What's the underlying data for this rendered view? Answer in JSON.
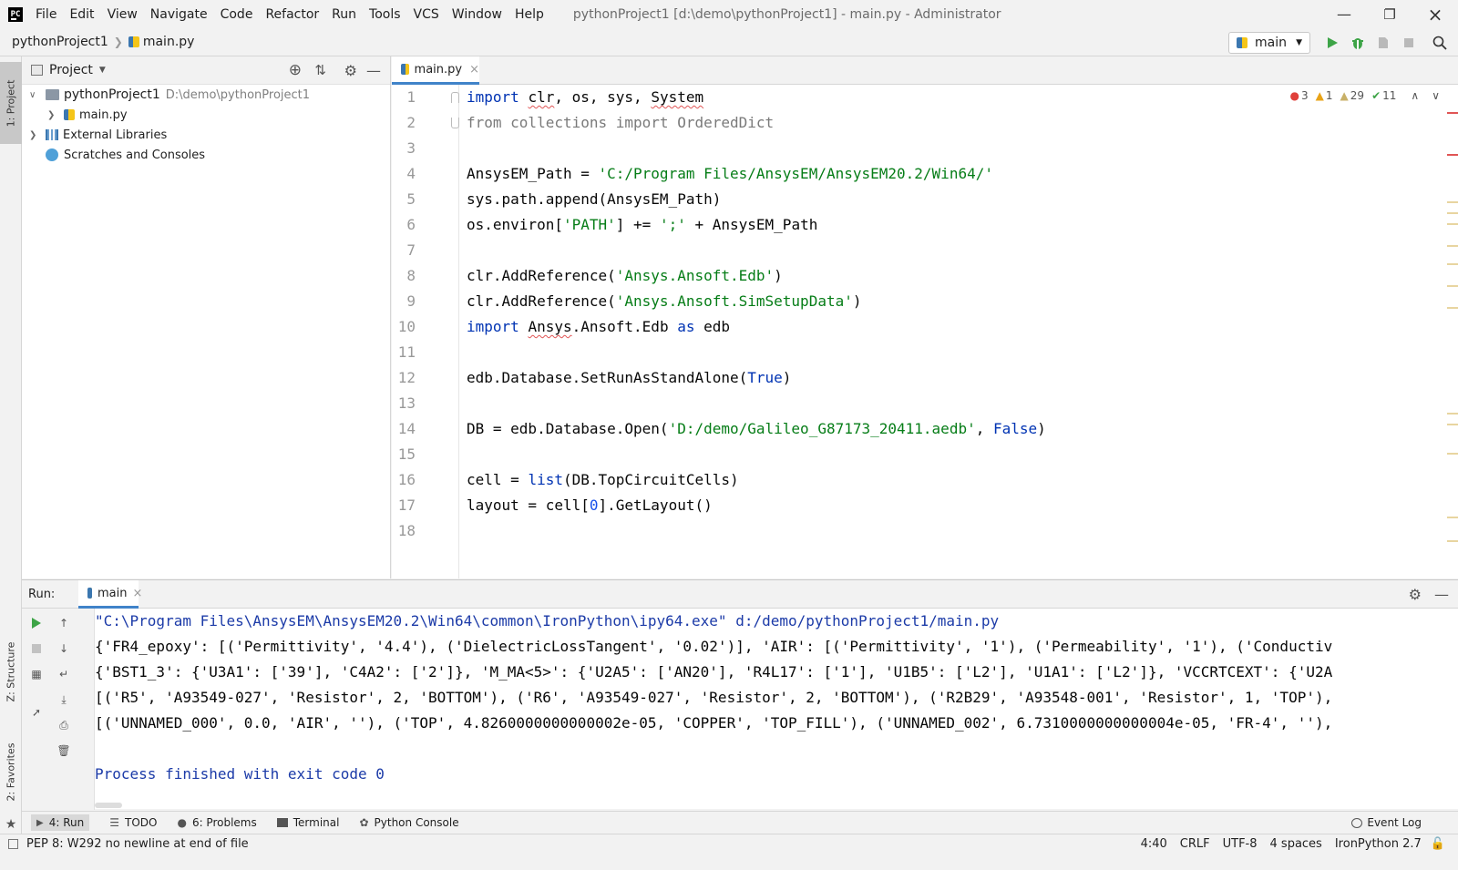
{
  "menu": [
    "File",
    "Edit",
    "View",
    "Navigate",
    "Code",
    "Refactor",
    "Run",
    "Tools",
    "VCS",
    "Window",
    "Help"
  ],
  "window_title": "pythonProject1 [d:\\demo\\pythonProject1] - main.py - Administrator",
  "breadcrumb": {
    "project": "pythonProject1",
    "file": "main.py"
  },
  "run_config": "main",
  "left_stripe": {
    "project_tab": "1: Project",
    "structure_tab": "Z: Structure",
    "favorites_tab": "2: Favorites"
  },
  "project_panel": {
    "title": "Project",
    "tree": {
      "root": "pythonProject1",
      "root_path": "D:\\demo\\pythonProject1",
      "file": "main.py",
      "external": "External Libraries",
      "scratches": "Scratches and Consoles"
    }
  },
  "editor": {
    "tab": "main.py",
    "inspections": {
      "errors": "3",
      "warnings": "1",
      "weak": "29",
      "ok": "11"
    },
    "line_numbers": [
      "1",
      "2",
      "3",
      "4",
      "5",
      "6",
      "7",
      "8",
      "9",
      "10",
      "11",
      "12",
      "13",
      "14",
      "15",
      "16",
      "17",
      "18"
    ]
  },
  "run_panel": {
    "label": "Run:",
    "tab": "main",
    "output": [
      "\"C:\\Program Files\\AnsysEM\\AnsysEM20.2\\Win64\\common\\IronPython\\ipy64.exe\" d:/demo/pythonProject1/main.py",
      "{'FR4_epoxy': [('Permittivity', '4.4'), ('DielectricLossTangent', '0.02')], 'AIR': [('Permittivity', '1'), ('Permeability', '1'), ('Conductiv",
      "{'BST1_3': {'U3A1': ['39'], 'C4A2': ['2']}, 'M_MA<5>': {'U2A5': ['AN20'], 'R4L17': ['1'], 'U1B5': ['L2'], 'U1A1': ['L2']}, 'VCCRTCEXT': {'U2A",
      "[('R5', 'A93549-027', 'Resistor', 2, 'BOTTOM'), ('R6', 'A93549-027', 'Resistor', 2, 'BOTTOM'), ('R2B29', 'A93548-001', 'Resistor', 1, 'TOP'),",
      "[('UNNAMED_000', 0.0, 'AIR', ''), ('TOP', 4.8260000000000002e-05, 'COPPER', 'TOP_FILL'), ('UNNAMED_002', 6.7310000000000004e-05, 'FR-4', ''),",
      "",
      "Process finished with exit code 0"
    ]
  },
  "bottom_tools": [
    {
      "label": "4: Run",
      "icon": "play-icon"
    },
    {
      "label": "TODO",
      "icon": "list-icon"
    },
    {
      "label": "6: Problems",
      "icon": "info-icon"
    },
    {
      "label": "Terminal",
      "icon": "terminal-icon"
    },
    {
      "label": "Python Console",
      "icon": "python-icon"
    }
  ],
  "event_log": "Event Log",
  "status": {
    "message": "PEP 8: W292 no newline at end of file",
    "position": "4:40",
    "line_sep": "CRLF",
    "encoding": "UTF-8",
    "indent": "4 spaces",
    "interpreter": "IronPython 2.7"
  },
  "colors": {
    "accent": "#4083c9",
    "keyword": "#0033b3",
    "string": "#067d17",
    "number": "#1750eb",
    "run_green": "#3da447"
  }
}
